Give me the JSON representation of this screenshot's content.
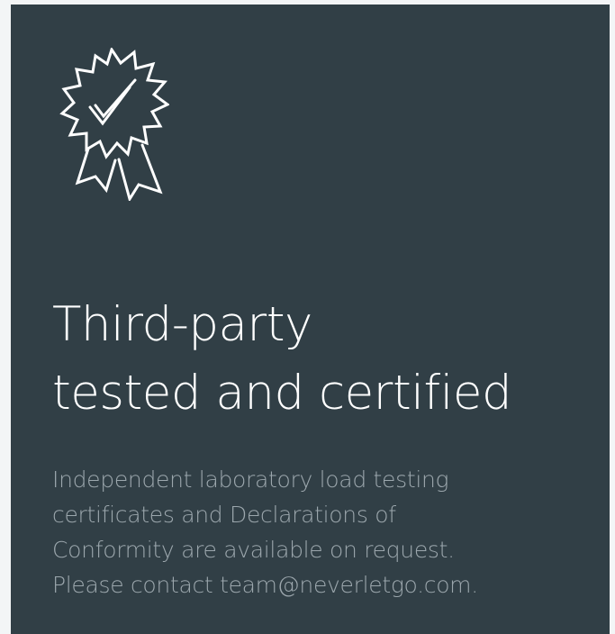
{
  "colors": {
    "page_background": "#f3f5f6",
    "card_background": "#313f46",
    "heading_text": "#ffffff",
    "body_text": "#9ca7ad",
    "icon_stroke": "#ffffff"
  },
  "card": {
    "icon": "certificate-badge-icon",
    "heading_lines": [
      "Third-party",
      "tested and certified"
    ],
    "body_lines": [
      "Independent laboratory load testing",
      "certificates and Declarations of",
      "Conformity are available on request.",
      "Please contact team@neverletgo.com."
    ]
  }
}
